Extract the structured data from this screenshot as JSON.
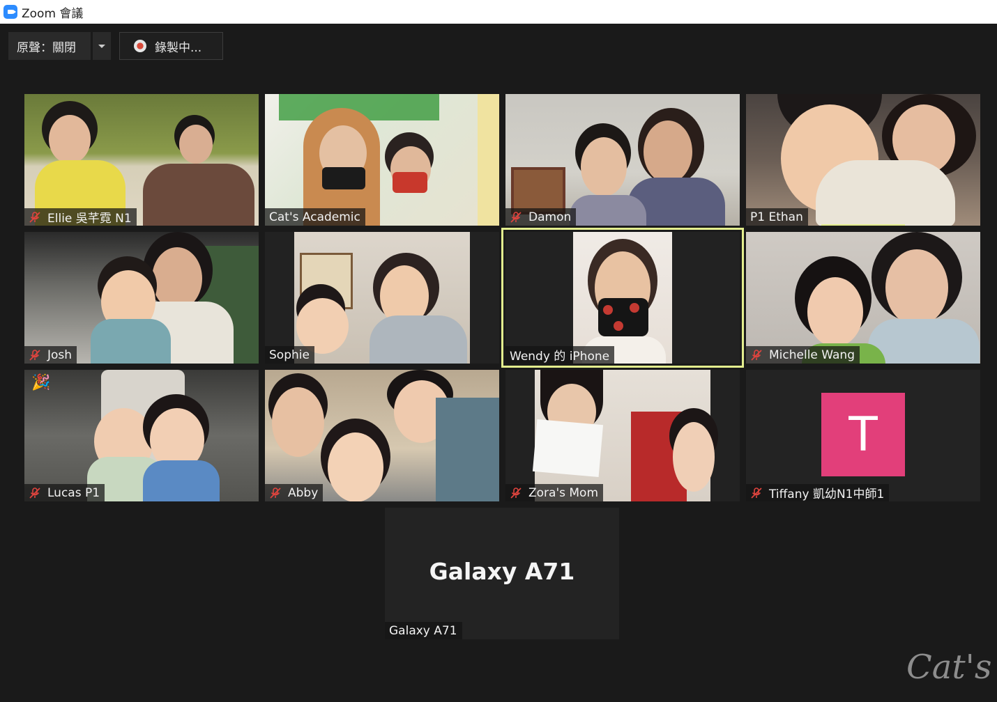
{
  "window": {
    "title": "Zoom 會議"
  },
  "toolbar": {
    "original_sound_label": "原聲：關閉",
    "recording_label": "錄製中..."
  },
  "participants": [
    {
      "name": "Ellie 吳芊霓 N1",
      "muted": true
    },
    {
      "name": "Cat's Academic",
      "muted": false
    },
    {
      "name": "Damon",
      "muted": true
    },
    {
      "name": "P1 Ethan",
      "muted": false
    },
    {
      "name": "Josh",
      "muted": true
    },
    {
      "name": "Sophie",
      "muted": false
    },
    {
      "name": "Wendy 的 iPhone",
      "muted": false
    },
    {
      "name": "Michelle Wang",
      "muted": true
    },
    {
      "name": "Lucas P1",
      "muted": true
    },
    {
      "name": "Abby",
      "muted": true
    },
    {
      "name": "Zora's Mom",
      "muted": true
    },
    {
      "name": "Tiffany 凱幼N1中師1",
      "muted": true,
      "avatar_letter": "T"
    },
    {
      "name": "Galaxy A71",
      "muted": false,
      "center_text": "Galaxy A71"
    }
  ],
  "watermark": "Cat's",
  "colors": {
    "accent": "#2d8cff",
    "active_speaker": "#e3ee8e",
    "mute": "#e0443e",
    "avatar_bg": "#e23f7a"
  }
}
